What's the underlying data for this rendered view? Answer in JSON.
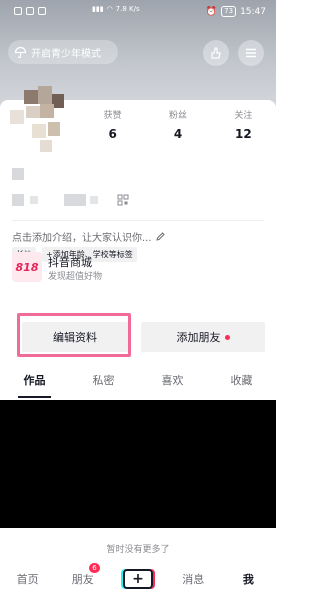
{
  "status_bar": {
    "network": "7.8 K/s",
    "battery": "73",
    "time": "15:47"
  },
  "header": {
    "teen_mode_label": "开启青少年模式"
  },
  "stats": [
    {
      "label": "获赞",
      "value": "6"
    },
    {
      "label": "粉丝",
      "value": "4"
    },
    {
      "label": "关注",
      "value": "12"
    }
  ],
  "profile": {
    "bio_placeholder": "点击添加介绍，让大家认识你...",
    "tag_location": "长沙",
    "tag_add": "添加年龄、学校等标签"
  },
  "mall": {
    "logo_text": "818",
    "title": "抖音商城",
    "subtitle": "发现超值好物"
  },
  "actions": {
    "edit_label": "编辑资料",
    "add_friend_label": "添加朋友"
  },
  "tabs": [
    "作品",
    "私密",
    "喜欢",
    "收藏"
  ],
  "empty_text": "暂时没有更多了",
  "bottom_nav": {
    "home": "首页",
    "friends": "朋友",
    "friends_badge": "6",
    "plus": "+",
    "messages": "消息",
    "me": "我"
  },
  "colors": {
    "accent": "#fe2c55",
    "highlight": "#f06b95"
  }
}
